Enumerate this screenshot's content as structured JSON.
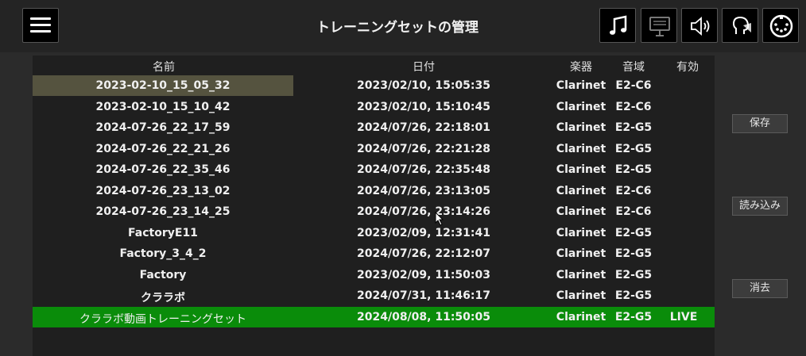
{
  "header": {
    "title": "トレーニングセットの管理"
  },
  "table": {
    "columns": {
      "name": "名前",
      "date": "日付",
      "instrument": "楽器",
      "range": "音域",
      "active": "有効"
    },
    "rows": [
      {
        "name": "2023-02-10_15_05_32",
        "date": "2023/02/10, 15:05:35",
        "instrument": "Clarinet",
        "range": "E2-C6",
        "active": ""
      },
      {
        "name": "2023-02-10_15_10_42",
        "date": "2023/02/10, 15:10:45",
        "instrument": "Clarinet",
        "range": "E2-C6",
        "active": ""
      },
      {
        "name": "2024-07-26_22_17_59",
        "date": "2024/07/26, 22:18:01",
        "instrument": "Clarinet",
        "range": "E2-G5",
        "active": ""
      },
      {
        "name": "2024-07-26_22_21_26",
        "date": "2024/07/26, 22:21:28",
        "instrument": "Clarinet",
        "range": "E2-G5",
        "active": ""
      },
      {
        "name": "2024-07-26_22_35_46",
        "date": "2024/07/26, 22:35:48",
        "instrument": "Clarinet",
        "range": "E2-G5",
        "active": ""
      },
      {
        "name": "2024-07-26_23_13_02",
        "date": "2024/07/26, 23:13:05",
        "instrument": "Clarinet",
        "range": "E2-C6",
        "active": ""
      },
      {
        "name": "2024-07-26_23_14_25",
        "date": "2024/07/26, 23:14:26",
        "instrument": "Clarinet",
        "range": "E2-C6",
        "active": ""
      },
      {
        "name": "FactoryE11",
        "date": "2023/02/09, 12:31:41",
        "instrument": "Clarinet",
        "range": "E2-G5",
        "active": ""
      },
      {
        "name": "Factory_3_4_2",
        "date": "2024/07/26, 22:12:07",
        "instrument": "Clarinet",
        "range": "E2-G5",
        "active": ""
      },
      {
        "name": "Factory",
        "date": "2023/02/09, 11:50:03",
        "instrument": "Clarinet",
        "range": "E2-G5",
        "active": ""
      },
      {
        "name": "クララボ",
        "date": "2024/07/31, 11:46:17",
        "instrument": "Clarinet",
        "range": "E2-G5",
        "active": ""
      },
      {
        "name": "クララボ動画トレーニングセット",
        "date": "2024/08/08, 11:50:05",
        "instrument": "Clarinet",
        "range": "E2-G5",
        "active": "LIVE"
      }
    ]
  },
  "side_buttons": {
    "save": "保存",
    "load": "読み込み",
    "delete": "消去"
  },
  "colors": {
    "live_row": "#0a8c0a",
    "selected_row": "#55533f"
  }
}
